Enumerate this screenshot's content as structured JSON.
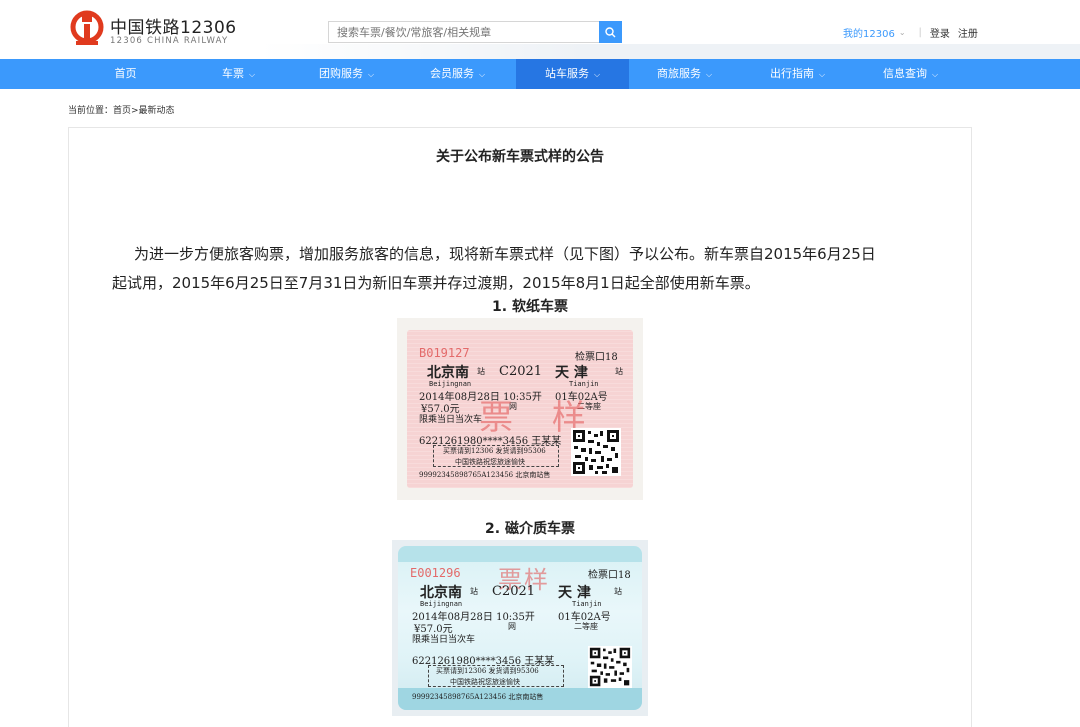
{
  "header": {
    "brand_cn": "中国铁路12306",
    "brand_en": "12306 CHINA RAILWAY",
    "search_placeholder": "搜索车票/餐饮/常旅客/相关规章",
    "my_account": "我的12306",
    "login": "登录",
    "register": "注册",
    "brand_color": "#e03a1e",
    "accent_color": "#3b99fc"
  },
  "nav": {
    "items": [
      {
        "label": "首页",
        "dropdown": false
      },
      {
        "label": "车票",
        "dropdown": true
      },
      {
        "label": "团购服务",
        "dropdown": true
      },
      {
        "label": "会员服务",
        "dropdown": true
      },
      {
        "label": "站车服务",
        "dropdown": true,
        "active": true
      },
      {
        "label": "商旅服务",
        "dropdown": true
      },
      {
        "label": "出行指南",
        "dropdown": true
      },
      {
        "label": "信息查询",
        "dropdown": true
      }
    ]
  },
  "breadcrumb": "当前位置：首页>最新动态",
  "article": {
    "title": "关于公布新车票式样的公告",
    "paragraph_line1": "为进一步方便旅客购票，增加服务旅客的信息，现将新车票式样（见下图）予以公布。新车票自2015年6月25日",
    "paragraph_line2": "起试用，2015年6月25日至7月31日为新旧车票并存过渡期，2015年8月1日起全部使用新车票。",
    "caption1": "1. 软纸车票",
    "caption2": "2.  磁介质车票"
  },
  "ticket1": {
    "serial": "B019127",
    "gate": "检票口18",
    "from": "北京南",
    "station_suffix": "站",
    "train": "C2021",
    "to": "天 津",
    "from_pinyin": "Beijingnan",
    "to_pinyin": "Tianjin",
    "datetime": "2014年08月28日 10:35开",
    "seat": "01车02A号",
    "price": "¥57.0元",
    "car_class": "网",
    "seat_class": "二等座",
    "limit": "限乘当日当次车",
    "stamp": "票  样",
    "id": "6221261980****3456 王某某",
    "notice1": "买票请到12306 发货请到95306",
    "notice2": "中国铁路祝您旅途愉快",
    "code": "99992345898765A123456  北京南站售"
  },
  "ticket2": {
    "serial": "E001296",
    "gate": "检票口18",
    "from": "北京南",
    "station_suffix": "站",
    "train": "C2021",
    "to": "天 津",
    "from_pinyin": "Beijingnan",
    "to_pinyin": "Tianjin",
    "datetime": "2014年08月28日 10:35开",
    "seat": "01车02A号",
    "price": "¥57.0元",
    "car_class": "网",
    "seat_class": "二等座",
    "limit": "限乘当日当次车",
    "stamp": "票样",
    "id": "6221261980****3456 王某某",
    "notice1": "买票请到12306 发货请到95306",
    "notice2": "中国铁路祝您旅途愉快",
    "code": "99992345898765A123456  北京南站售"
  }
}
